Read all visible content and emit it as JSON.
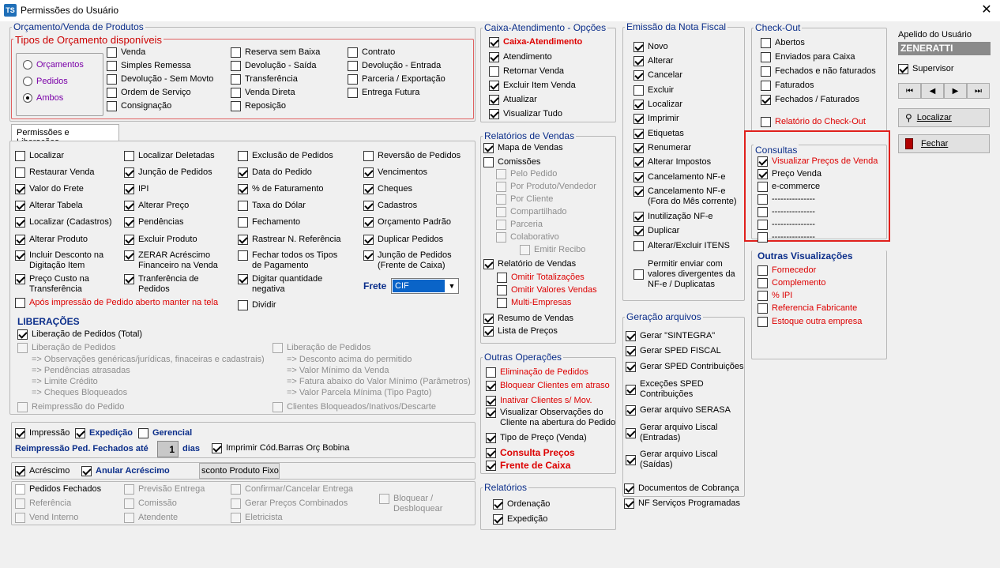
{
  "window": {
    "title": "Permissões do Usuário",
    "icon": "TS",
    "close": "✕"
  },
  "orc": {
    "title": "Orçamento/Venda de Produtos",
    "tipos_title": "Tipos de Orçamento disponíveis",
    "radios": [
      "Orçamentos",
      "Pedidos",
      "Ambos"
    ],
    "col1": [
      "Venda",
      "Simples Remessa",
      "Devolução - Sem Movto",
      "Ordem de Serviço",
      "Consignação"
    ],
    "col2": [
      "Reserva sem Baixa",
      "Devolução - Saída",
      "Transferência",
      "Venda Direta",
      "Reposição"
    ],
    "col3": [
      "Contrato",
      "Devolução - Entrada",
      "Parceria / Exportação",
      "Entrega Futura"
    ]
  },
  "tab": {
    "label": "Permissões e Liberações"
  },
  "perm": {
    "c1": [
      "Localizar",
      "Restaurar Venda",
      "Valor do Frete",
      "Alterar Tabela",
      "Localizar (Cadastros)",
      "Alterar Produto",
      "Incluir Desconto na Digitação Item",
      "Preço Custo na Transferência"
    ],
    "c2": [
      "Localizar Deletadas",
      "Junção de Pedidos",
      "IPI",
      "Alterar Preço",
      "Pendências",
      "Excluir Produto",
      "ZERAR Acréscimo Financeiro na Venda",
      "Tranferência de Pedidos"
    ],
    "c3": [
      "Exclusão de Pedidos",
      "Data do Pedido",
      "%  de Faturamento",
      "Taxa do Dólar",
      "Fechamento",
      "Rastrear N. Referência",
      "Fechar todos os Tipos de Pagamento",
      "Digitar quantidade negativa",
      "Dividir"
    ],
    "c4": [
      "Reversão de Pedidos",
      "Vencimentos",
      "Cheques",
      "Cadastros",
      "Orçamento Padrão",
      "Duplicar Pedidos",
      "Junção de Pedidos (Frente de Caixa)"
    ],
    "apos": "Após impressão de Pedido aberto manter na tela",
    "frete_label": "Frete",
    "frete_value": "CIF"
  },
  "lib": {
    "title": "LIBERAÇÕES",
    "total": "Liberação de Pedidos (Total)",
    "left_title": "Liberação de Pedidos",
    "left_lines": [
      "=> Observações genéricas/jurídicas, finaceiras e cadastrais)",
      "=> Pendências atrasadas",
      "=> Limite Crédito",
      "=> Cheques Bloqueados"
    ],
    "right_title": "Liberação de Pedidos",
    "right_lines": [
      "=> Desconto acima do permitido",
      "=> Valor Mínimo da Venda",
      "=> Fatura abaixo do Valor Mínimo (Parâmetros)",
      "=> Valor Parcela Mínima (Tipo Pagto)"
    ],
    "reimpressao": "Reimpressão do Pedido",
    "clientes_bloq": "Clientes Bloqueados/Inativos/Descarte"
  },
  "bottom": {
    "impressao": "Impressão",
    "expedicao": "Expedição",
    "gerencial": "Gerencial",
    "reimp_label": "Reimpressão Ped. Fechados até",
    "reimp_value": "1",
    "dias": "dias",
    "imprimir": "Imprimir Cód.Barras Orç Bobina",
    "acrescimo": "Acréscimo",
    "anular": "Anular Acréscimo",
    "desconto": "sconto Produto Fixo",
    "dis": [
      "Pedidos Fechados",
      "Referência",
      "Vend Interno",
      "Previsão Entrega",
      "Comissão",
      "Atendente",
      "Confirmar/Cancelar Entrega",
      "Gerar Preços Combinados",
      "Eletricista",
      "Bloquear / Desbloquear"
    ]
  },
  "caixa": {
    "title": "Caixa-Atendimento - Opções",
    "items": [
      "Caixa-Atendimento",
      "Atendimento",
      "Retornar Venda",
      "Excluir Item Venda",
      "Atualizar",
      "Visualizar Tudo"
    ]
  },
  "relv": {
    "title": "Relatórios de Vendas",
    "items": [
      "Mapa de Vendas",
      "Comissões",
      "Pelo Pedido",
      "Por Produto/Vendedor",
      "Por Cliente",
      "Compartilhado",
      "Parceria",
      "Colaborativo",
      "Emitir Recibo",
      "Relatório de Vendas",
      "Omitir Totalizações",
      "Omitir Valores Vendas",
      "Multi-Empresas",
      "Resumo de Vendas",
      "Lista de Preços"
    ]
  },
  "outras": {
    "title": "Outras Operações",
    "items": [
      "Eliminação de Pedidos",
      "Bloquear Clientes em atraso",
      "Inativar Clientes s/ Mov.",
      "Visualizar Observações do Cliente na abertura do Pedido",
      "Tipo de Preço (Venda)",
      "Consulta Preços",
      "Frente de Caixa"
    ]
  },
  "rel": {
    "title": "Relatórios",
    "items": [
      "Ordenação",
      "Expedição"
    ]
  },
  "nf": {
    "title": "Emissão da Nota Fiscal",
    "items": [
      "Novo",
      "Alterar",
      "Cancelar",
      "Excluir",
      "Localizar",
      "Imprimir",
      "Etiquetas",
      "Renumerar",
      "Alterar Impostos",
      "Cancelamento NF-e",
      "Cancelamento NF-e (Fora do Mês corrente)",
      "Inutilização NF-e",
      "Duplicar",
      "Alterar/Excluir ITENS",
      "Permitir enviar com valores divergentes da NF-e / Duplicatas"
    ]
  },
  "ger": {
    "title": "Geração arquivos",
    "items": [
      "Gerar \"SINTEGRA\"",
      "Gerar SPED FISCAL",
      "Gerar SPED Contribuições",
      "Exceções SPED Contribuições",
      "Gerar arquivo SERASA",
      "Gerar arquivo Liscal (Entradas)",
      "Gerar arquivo Liscal (Saídas)"
    ],
    "doc": "Documentos de Cobrança",
    "nfserv": "NF Serviços Programadas"
  },
  "checkout": {
    "title": "Check-Out",
    "items": [
      "Abertos",
      "Enviados para Caixa",
      "Fechados e não faturados",
      "Faturados",
      "Fechados / Faturados"
    ],
    "rel": "Relatório do Check-Out"
  },
  "consultas": {
    "title": "Consultas",
    "items": [
      "Visualizar Preços de Venda",
      "Preço Venda",
      "e-commerce",
      "---------------",
      "---------------",
      "---------------",
      "---------------"
    ]
  },
  "outrasvis": {
    "title": "Outras Visualizações",
    "items": [
      "Fornecedor",
      "Complemento",
      "% IPI",
      "Referencia Fabricante",
      "Estoque outra empresa"
    ]
  },
  "user": {
    "label": "Apelido do Usuário",
    "value": "ZENERATTI",
    "supervisor": "Supervisor",
    "localizar": "Localizar",
    "fechar": "Fechar"
  },
  "colors": {
    "highlight": "#e0201c",
    "blue_title": "#0b2e8a",
    "red_text": "#dd0000",
    "nav_field": "#0a64c8"
  }
}
